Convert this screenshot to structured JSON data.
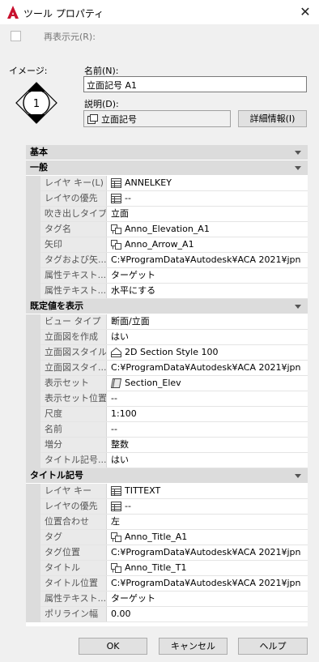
{
  "window": {
    "title": "ツール プロパティ"
  },
  "redisplay_checkbox": {
    "label": "再表示元(R):",
    "checked": false
  },
  "image_label": "イメージ:",
  "symbol_number": "1",
  "name": {
    "label": "名前(N):",
    "value": "立面記号 A1"
  },
  "description": {
    "label": "説明(D):",
    "value": "立面記号"
  },
  "detail_button": "詳細情報(I)",
  "grid": {
    "top_category": "基本",
    "sections": [
      {
        "title": "一般",
        "rows": [
          {
            "name": "レイヤ キー(L)",
            "value": "ANNELKEY",
            "icon": "layer-key-icon"
          },
          {
            "name": "レイヤの優先",
            "value": "--",
            "icon": "layer-key-icon"
          },
          {
            "name": "吹き出しタイプ",
            "value": "立面",
            "icon": ""
          },
          {
            "name": "タグ名",
            "value": "Anno_Elevation_A1",
            "icon": "block-icon"
          },
          {
            "name": "矢印",
            "value": "Anno_Arrow_A1",
            "icon": "block-icon"
          },
          {
            "name": "タグおよび矢...",
            "value": "C:¥ProgramData¥Autodesk¥ACA  2021¥jpn",
            "icon": ""
          },
          {
            "name": "属性テキスト...",
            "value": "ターゲット",
            "icon": ""
          },
          {
            "name": "属性テキスト...",
            "value": "水平にする",
            "icon": ""
          }
        ]
      },
      {
        "title": "既定値を表示",
        "rows": [
          {
            "name": "ビュー タイプ",
            "value": "断面/立面",
            "icon": ""
          },
          {
            "name": "立面図を作成",
            "value": "はい",
            "icon": ""
          },
          {
            "name": "立面図スタイル",
            "value": "2D Section Style 100",
            "icon": "section-style-icon"
          },
          {
            "name": "立面図スタイ...",
            "value": "C:¥ProgramData¥Autodesk¥ACA  2021¥jpn",
            "icon": ""
          },
          {
            "name": "表示セット",
            "value": "Section_Elev",
            "icon": "display-set-icon"
          },
          {
            "name": "表示セット位置",
            "value": "--",
            "icon": ""
          },
          {
            "name": "尺度",
            "value": "1:100",
            "icon": ""
          },
          {
            "name": "名前",
            "value": "--",
            "icon": ""
          },
          {
            "name": "増分",
            "value": "整数",
            "icon": ""
          },
          {
            "name": "タイトル記号...",
            "value": "はい",
            "icon": ""
          }
        ]
      },
      {
        "title": "タイトル記号",
        "rows": [
          {
            "name": "レイヤ キー",
            "value": "TITTEXT",
            "icon": "layer-key-icon"
          },
          {
            "name": "レイヤの優先",
            "value": "--",
            "icon": "layer-key-icon"
          },
          {
            "name": "位置合わせ",
            "value": "左",
            "icon": ""
          },
          {
            "name": "タグ",
            "value": "Anno_Title_A1",
            "icon": "block-icon"
          },
          {
            "name": "タグ位置",
            "value": "C:¥ProgramData¥Autodesk¥ACA  2021¥jpn",
            "icon": ""
          },
          {
            "name": "タイトル",
            "value": "Anno_Title_T1",
            "icon": "block-icon"
          },
          {
            "name": "タイトル位置",
            "value": "C:¥ProgramData¥Autodesk¥ACA  2021¥jpn",
            "icon": ""
          },
          {
            "name": "属性テキスト...",
            "value": "ターゲット",
            "icon": ""
          },
          {
            "name": "ポリライン幅",
            "value": "0.00",
            "icon": ""
          }
        ]
      }
    ]
  },
  "buttons": {
    "ok": "OK",
    "cancel": "キャンセル",
    "help": "ヘルプ"
  },
  "colors": {
    "accent": "#c8102e",
    "category_bg": "#dcdcdc",
    "name_cell_bg": "#eaeaea"
  }
}
